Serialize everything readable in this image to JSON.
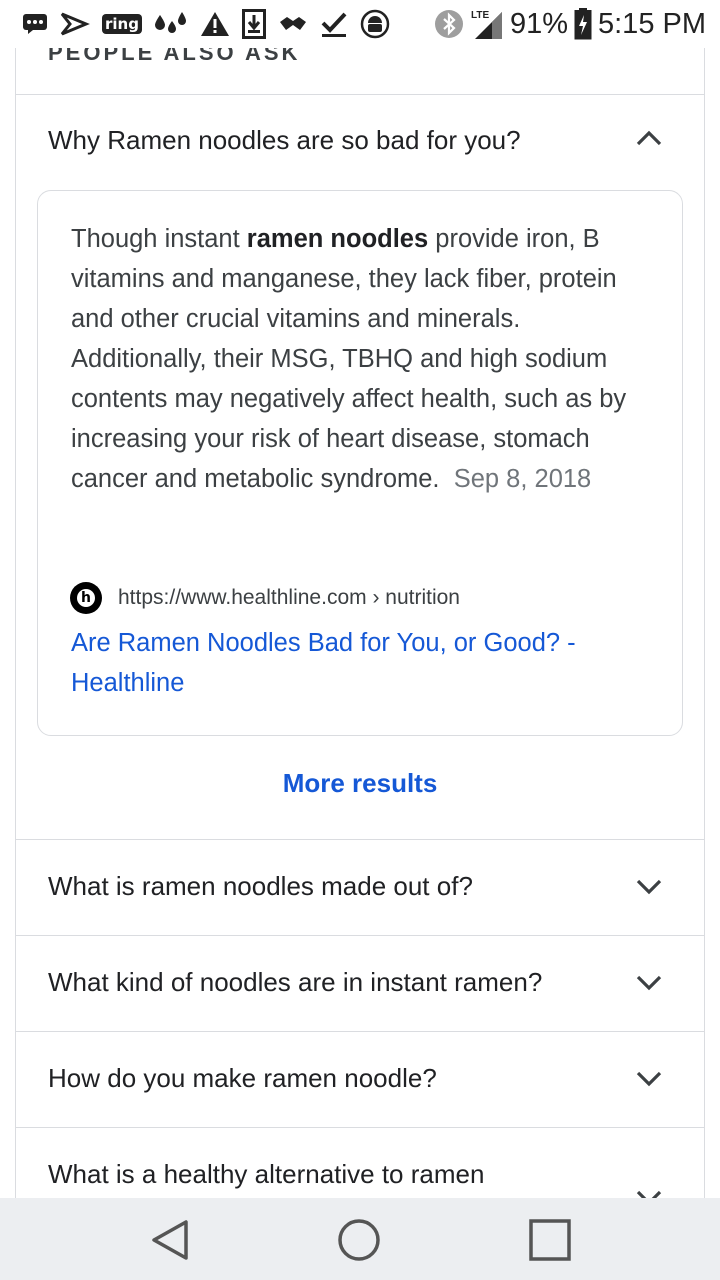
{
  "status_bar": {
    "ring_label": "ring",
    "lte_label": "LTE",
    "battery": "91%",
    "time": "5:15 PM"
  },
  "partial_header": "PEOPLE ALSO ASK",
  "expanded_question": "Why Ramen noodles are so bad for you?",
  "answer": {
    "text_before": "Though instant ",
    "bold": "ramen noodles",
    "text_after": " provide iron, B vitamins and manganese, they lack fiber, protein and other crucial vitamins and minerals. Additionally, their MSG, TBHQ and high sodium contents may negatively affect health, such as by increasing your risk of heart disease, stomach cancer and metabolic syndrome.",
    "date": "Sep 8, 2018",
    "favicon_letter": "h",
    "source_url": "https://www.healthline.com › nutrition",
    "link_title": "Are Ramen Noodles Bad for You, or Good? - Healthline"
  },
  "more_results": "More results",
  "questions": [
    "What is ramen noodles made out of?",
    "What kind of noodles are in instant ramen?",
    "How do you make ramen noodle?",
    "What is a healthy alternative to ramen"
  ],
  "icons": {
    "status_left": [
      "chat-icon",
      "sprint-icon",
      "ring-icon",
      "drops-icon",
      "warning-icon",
      "download-icon",
      "handshake-icon",
      "check-icon",
      "android-icon"
    ],
    "status_right": [
      "bluetooth-icon",
      "signal-icon",
      "battery-icon"
    ],
    "nav": [
      "back-icon",
      "home-icon",
      "recents-icon"
    ]
  },
  "colors": {
    "link": "#1558d6",
    "divider": "#dadce0",
    "nav_bg": "#eceef1"
  }
}
